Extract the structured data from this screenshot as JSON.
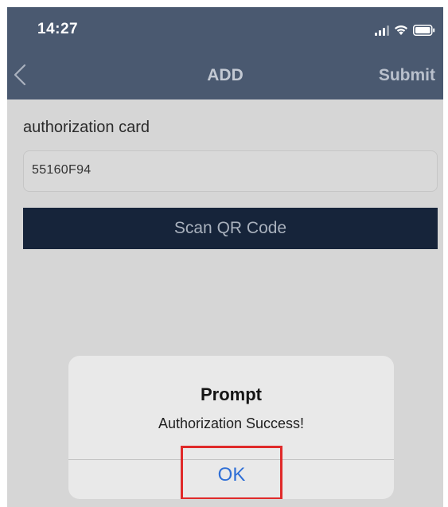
{
  "status_bar": {
    "time": "14:27",
    "icons": [
      "signal-icon",
      "wifi-icon",
      "battery-icon"
    ]
  },
  "nav": {
    "back_icon": "chevron-left-icon",
    "title": "ADD",
    "submit_label": "Submit"
  },
  "form": {
    "section_label": "authorization card",
    "card_value": "55160F94",
    "scan_button_label": "Scan QR Code"
  },
  "dialog": {
    "title": "Prompt",
    "message": "Authorization Success!",
    "ok_label": "OK"
  },
  "colors": {
    "nav_background": "#4a5970",
    "scan_button": "#16243a",
    "ok_text": "#2f6fd6",
    "highlight_box": "#e02a2a",
    "overlay_background": "#d6d6d6"
  }
}
